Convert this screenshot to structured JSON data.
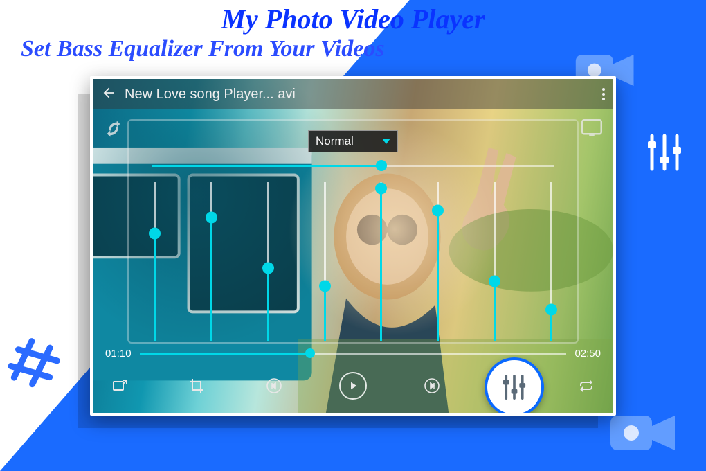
{
  "header": {
    "title": "My Photo  Video Player",
    "subtitle": "Set Bass Equalizer From Your Videos"
  },
  "player": {
    "topbar": {
      "title": "New Love song Player... avi"
    },
    "eq": {
      "preset_label": "Normal",
      "h_progress_pct": 57,
      "bands_pct": [
        68,
        78,
        46,
        35,
        96,
        82,
        38,
        20
      ]
    },
    "seek": {
      "current": "01:10",
      "total": "02:50",
      "progress_pct": 40
    }
  },
  "colors": {
    "accent": "#00d8e8",
    "blue": "#1a6bff"
  }
}
